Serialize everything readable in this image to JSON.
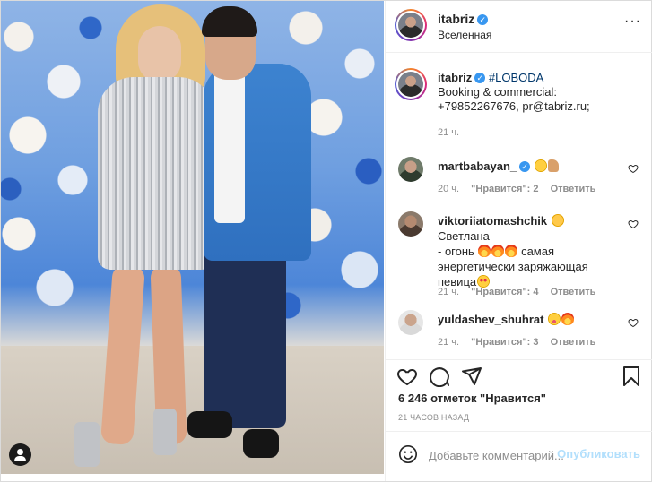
{
  "post": {
    "author": "itabriz",
    "location": "Вселенная",
    "caption": {
      "username": "itabriz",
      "tag": "#LOBODA",
      "lines": [
        "Booking & commercial:",
        "+79852267676, pr@tabriz.ru;"
      ],
      "time": "21 ч."
    },
    "comments": [
      {
        "username": "martbabayan_",
        "verified": true,
        "emojis": [
          "smiling-face",
          "thumbs-up"
        ],
        "time": "20 ч.",
        "likes": "\"Нравится\": 2",
        "reply": "Ответить"
      },
      {
        "username": "viktoriiatomashchik",
        "text_1": "Светлана",
        "text_2": "- огонь",
        "text_3": "самая",
        "text_4": "энергетически заряжающая",
        "text_5": "певица",
        "time": "21 ч.",
        "likes": "\"Нравится\": 4",
        "reply": "Ответить"
      },
      {
        "username": "yuldashev_shuhrat",
        "time": "21 ч.",
        "likes": "\"Нравится\": 3",
        "reply": "Ответить"
      }
    ],
    "likes_count": "6 246 отметок \"Нравится\"",
    "timestamp": "21 ЧАСОВ НАЗАД",
    "add_comment": {
      "placeholder": "Добавьте комментарий...",
      "post_label": "Опубликовать"
    },
    "icons": {
      "verified": "verified-badge-icon",
      "more": "more-options-icon",
      "like": "heart-icon",
      "comment": "comment-bubble-icon",
      "share": "paper-plane-icon",
      "save": "bookmark-icon",
      "emoji": "emoji-icon",
      "tag": "user-tag-icon"
    },
    "colors": {
      "verified": "#3897f0",
      "link": "#00376b",
      "muted": "#8e8e8e",
      "post_button_disabled": "#b2dffc"
    }
  }
}
